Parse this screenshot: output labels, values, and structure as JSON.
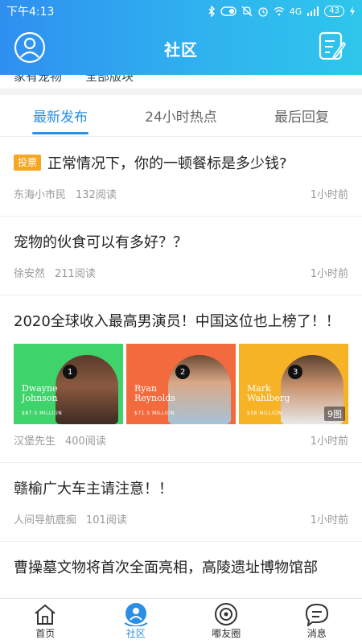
{
  "status_bar": {
    "time": "下午4:13",
    "network": "4G",
    "battery": "43"
  },
  "header": {
    "title": "社区",
    "left_icon": "user-avatar-icon",
    "right_icon": "compose-icon"
  },
  "filters": [
    "家有宠物",
    "全部版块"
  ],
  "tabs": [
    {
      "label": "最新发布",
      "active": true
    },
    {
      "label": "24小时热点",
      "active": false
    },
    {
      "label": "最后回复",
      "active": false
    }
  ],
  "posts": [
    {
      "tag": "投票",
      "title": "正常情况下，你的一顿餐标是多少钱?",
      "author": "东海小市民",
      "reads": "132阅读",
      "time": "1小时前"
    },
    {
      "title": "宠物的伙食可以有多好？？",
      "author": "徐安然",
      "reads": "211阅读",
      "time": "1小时前"
    },
    {
      "title": "2020全球收入最高男演员！中国这位也上榜了！！",
      "author": "汉堡先生",
      "reads": "400阅读",
      "time": "1小时前",
      "images": [
        {
          "rank": "1",
          "name": "Dwayne Johnson",
          "money": "$87.5 MILLION",
          "bg": "#3fd36b"
        },
        {
          "rank": "2",
          "name": "Ryan Reynolds",
          "money": "$71.5 MILLION",
          "bg": "#f26a3d"
        },
        {
          "rank": "3",
          "name": "Mark Wahlberg",
          "money": "$58 MILLION",
          "bg": "#f6b325"
        }
      ],
      "image_count": "9图"
    },
    {
      "title": "赣榆广大车主请注意！！",
      "author": "人间导航鹿痴",
      "reads": "101阅读",
      "time": "1小时前"
    },
    {
      "title": "曹操墓文物将首次全面亮相，高陵遗址博物馆部"
    }
  ],
  "bottom_nav": [
    {
      "label": "首页",
      "icon": "home-icon",
      "active": false
    },
    {
      "label": "社区",
      "icon": "community-icon",
      "active": true
    },
    {
      "label": "嘟友圈",
      "icon": "friends-circle-icon",
      "active": false
    },
    {
      "label": "消息",
      "icon": "message-icon",
      "active": false
    }
  ],
  "colors": {
    "accent": "#2a8fe6",
    "vote_tag": "#f5a623"
  }
}
